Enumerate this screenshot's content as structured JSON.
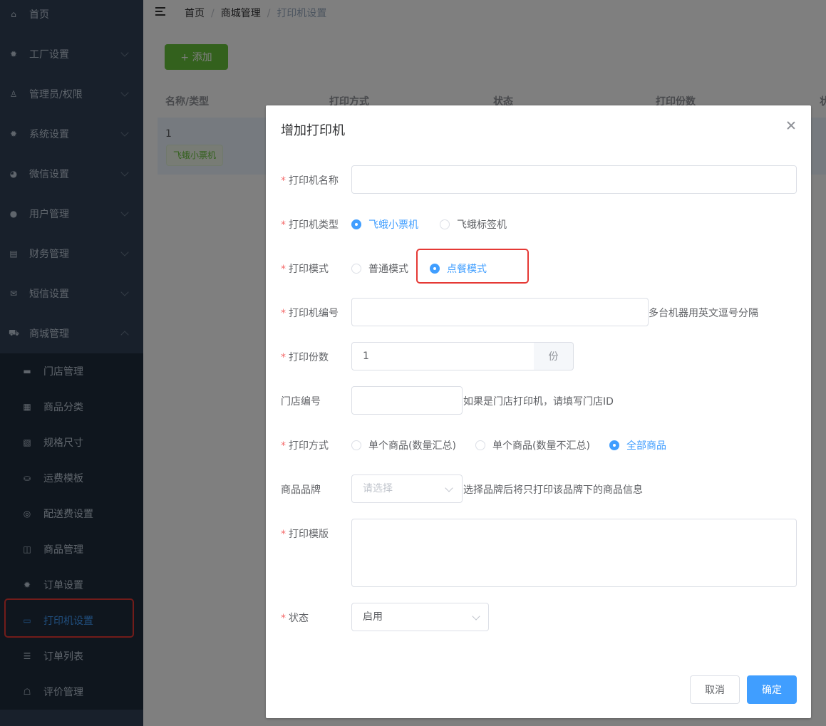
{
  "sidebar": {
    "items": [
      {
        "label": "首页",
        "icon": "home-icon",
        "glyph": "⌂"
      },
      {
        "label": "工厂设置",
        "icon": "gear-icon",
        "glyph": "✹"
      },
      {
        "label": "管理员/权限",
        "icon": "admin-icon",
        "glyph": "♙"
      },
      {
        "label": "系统设置",
        "icon": "gear-icon",
        "glyph": "✹"
      },
      {
        "label": "微信设置",
        "icon": "wechat-icon",
        "glyph": "◕"
      },
      {
        "label": "用户管理",
        "icon": "user-icon",
        "glyph": "●"
      },
      {
        "label": "财务管理",
        "icon": "finance-icon",
        "glyph": "▤"
      },
      {
        "label": "短信设置",
        "icon": "sms-icon",
        "glyph": "✉"
      },
      {
        "label": "商城管理",
        "icon": "cart-icon",
        "glyph": "⛟"
      }
    ],
    "subitems": [
      {
        "label": "门店管理",
        "icon": "store-icon",
        "glyph": "▬"
      },
      {
        "label": "商品分类",
        "icon": "grid-icon",
        "glyph": "▦"
      },
      {
        "label": "规格尺寸",
        "icon": "size-icon",
        "glyph": "▧"
      },
      {
        "label": "运费模板",
        "icon": "freight-icon",
        "glyph": "⛀"
      },
      {
        "label": "配送费设置",
        "icon": "delivery-icon",
        "glyph": "◎"
      },
      {
        "label": "商品管理",
        "icon": "bag-icon",
        "glyph": "◫"
      },
      {
        "label": "订单设置",
        "icon": "gear-icon",
        "glyph": "✹"
      },
      {
        "label": "打印机设置",
        "icon": "printer-icon",
        "glyph": "▭"
      },
      {
        "label": "订单列表",
        "icon": "list-icon",
        "glyph": "☰"
      },
      {
        "label": "评价管理",
        "icon": "review-icon",
        "glyph": "☖"
      }
    ]
  },
  "breadcrumb": [
    "首页",
    "商城管理",
    "打印机设置"
  ],
  "toolbar": {
    "add_label": "+ 添加"
  },
  "table": {
    "columns": [
      "名称/类型",
      "打印方式",
      "状态",
      "打印份数",
      "状"
    ],
    "rows": [
      {
        "name": "1",
        "tag": "飞蛾小票机"
      }
    ]
  },
  "dialog": {
    "title": "增加打印机",
    "fields": {
      "name": {
        "label": "打印机名称",
        "value": ""
      },
      "type": {
        "label": "打印机类型",
        "options": [
          "飞蛾小票机",
          "飞蛾标签机"
        ],
        "selected": "飞蛾小票机"
      },
      "mode": {
        "label": "打印模式",
        "options": [
          "普通模式",
          "点餐模式"
        ],
        "selected": "点餐模式"
      },
      "sn": {
        "label": "打印机编号",
        "value": "",
        "hint": "多台机器用英文逗号分隔"
      },
      "copies": {
        "label": "打印份数",
        "value": "1",
        "unit": "份"
      },
      "store": {
        "label": "门店编号",
        "value": "",
        "hint": "如果是门店打印机，请填写门店ID"
      },
      "method": {
        "label": "打印方式",
        "options": [
          "单个商品(数量汇总)",
          "单个商品(数量不汇总)",
          "全部商品"
        ],
        "selected": "全部商品"
      },
      "brand": {
        "label": "商品品牌",
        "placeholder": "请选择",
        "hint": "选择品牌后将只打印该品牌下的商品信息"
      },
      "template": {
        "label": "打印模版",
        "value": ""
      },
      "status": {
        "label": "状态",
        "value": "启用"
      }
    },
    "cancel_label": "取消",
    "ok_label": "确定"
  },
  "colors": {
    "primary": "#409eff",
    "success": "#67c23a",
    "sidebar": "#304156",
    "submenu": "#1f2d3d",
    "highlight": "#e53935"
  }
}
